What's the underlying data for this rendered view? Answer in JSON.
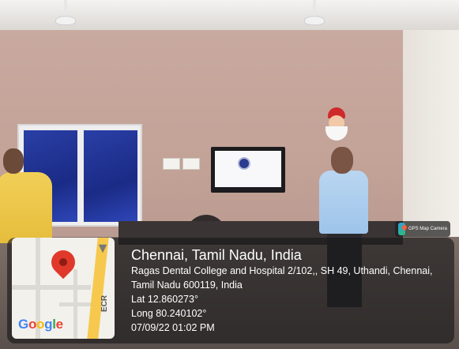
{
  "location": {
    "title": "Chennai, Tamil Nadu, India",
    "address_line1": "Ragas Dental College and Hospital 2/102,, SH 49, Uthandi, Chennai,",
    "address_line2": "Tamil Nadu 600119, India",
    "latitude": "Lat 12.860273°",
    "longitude": "Long 80.240102°",
    "datetime": "07/09/22 01:02 PM"
  },
  "map": {
    "road_label": "ECR",
    "logo_letters": [
      "G",
      "o",
      "o",
      "g",
      "l",
      "e"
    ],
    "logo_colors": [
      "#4285F4",
      "#EA4335",
      "#FBBC05",
      "#4285F4",
      "#34A853",
      "#EA4335"
    ],
    "pin_icon": "map-pin-icon",
    "nav_icon": "navigation-arrow-icon"
  },
  "app_badge": {
    "name": "GPS Map Camera",
    "icon": "gps-map-camera-icon"
  }
}
